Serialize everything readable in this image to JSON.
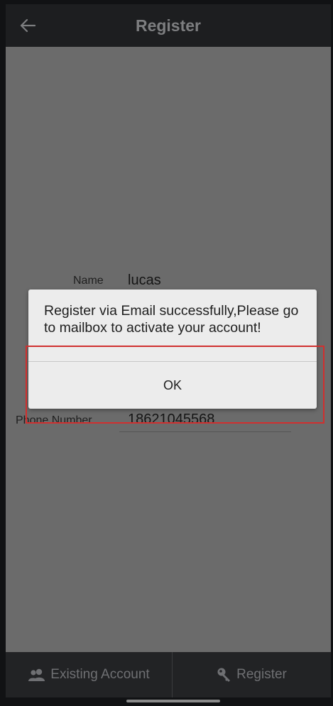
{
  "header": {
    "title": "Register"
  },
  "form": {
    "name_label": "Name",
    "name_value": "lucas",
    "phone_label": "Phone Number",
    "phone_value": "18621045568"
  },
  "dialog": {
    "message": "Register via Email successfully,Please go to mailbox to activate your account!",
    "ok_label": "OK"
  },
  "bottom_tabs": [
    {
      "label": "Existing Account",
      "icon": "users-icon"
    },
    {
      "label": "Register",
      "icon": "key-icon"
    }
  ],
  "colors": {
    "highlight": "#d0302f"
  }
}
